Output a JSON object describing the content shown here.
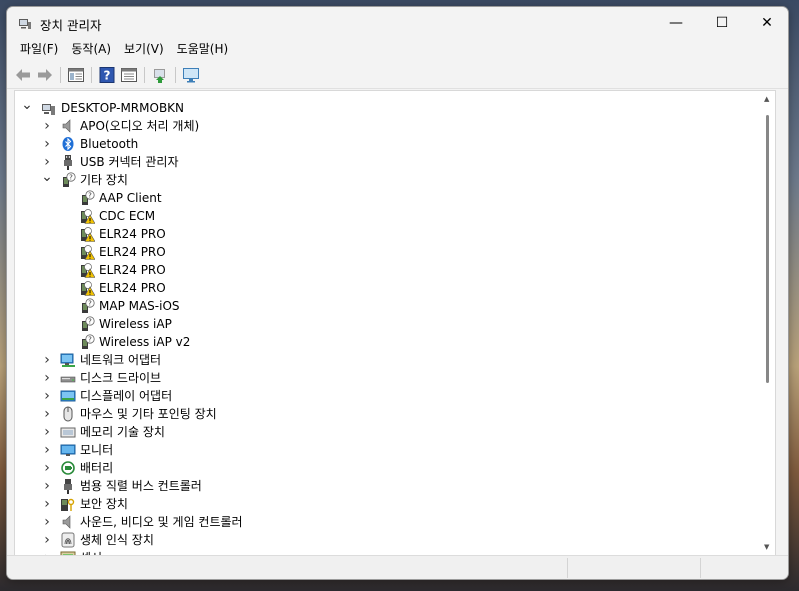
{
  "window": {
    "title": "장치 관리자",
    "controls": {
      "minimize": "—",
      "maximize": "☐",
      "close": "✕"
    }
  },
  "menu": [
    "파일(F)",
    "동작(A)",
    "보기(V)",
    "도움말(H)"
  ],
  "toolbar": [
    "back-icon",
    "forward-icon",
    "properties-view-icon",
    "help-icon",
    "show-hide-console-tree-icon",
    "update-driver-icon",
    "monitor-scan-icon"
  ],
  "tree": {
    "root": "DESKTOP-MRMOBKN",
    "items": [
      {
        "label": "APO(오디오 처리 개체)",
        "icon": "speaker-icon",
        "expanded": false
      },
      {
        "label": "Bluetooth",
        "icon": "bluetooth-icon",
        "expanded": false
      },
      {
        "label": "USB 커넥터 관리자",
        "icon": "usb-plug-icon",
        "expanded": false
      },
      {
        "label": "기타 장치",
        "icon": "unknown-device-icon",
        "expanded": true,
        "children": [
          {
            "label": "AAP Client",
            "icon": "unknown-device-icon"
          },
          {
            "label": "CDC ECM",
            "icon": "warning-device-icon"
          },
          {
            "label": "ELR24 PRO",
            "icon": "warning-device-icon"
          },
          {
            "label": "ELR24 PRO",
            "icon": "warning-device-icon"
          },
          {
            "label": "ELR24 PRO",
            "icon": "warning-device-icon"
          },
          {
            "label": "ELR24 PRO",
            "icon": "warning-device-icon"
          },
          {
            "label": "MAP MAS-iOS",
            "icon": "unknown-device-icon"
          },
          {
            "label": "Wireless iAP",
            "icon": "unknown-device-icon"
          },
          {
            "label": "Wireless iAP v2",
            "icon": "unknown-device-icon"
          }
        ]
      },
      {
        "label": "네트워크 어댑터",
        "icon": "network-adapter-icon",
        "expanded": false
      },
      {
        "label": "디스크 드라이브",
        "icon": "disk-drive-icon",
        "expanded": false
      },
      {
        "label": "디스플레이 어댑터",
        "icon": "display-adapter-icon",
        "expanded": false
      },
      {
        "label": "마우스 및 기타 포인팅 장치",
        "icon": "mouse-icon",
        "expanded": false
      },
      {
        "label": "메모리 기술 장치",
        "icon": "memory-device-icon",
        "expanded": false
      },
      {
        "label": "모니터",
        "icon": "monitor-icon",
        "expanded": false
      },
      {
        "label": "배터리",
        "icon": "battery-icon",
        "expanded": false
      },
      {
        "label": "범용 직렬 버스 컨트롤러",
        "icon": "usb-controller-icon",
        "expanded": false
      },
      {
        "label": "보안 장치",
        "icon": "security-device-icon",
        "expanded": false
      },
      {
        "label": "사운드, 비디오 및 게임 컨트롤러",
        "icon": "sound-icon",
        "expanded": false
      },
      {
        "label": "생체 인식 장치",
        "icon": "fingerprint-icon",
        "expanded": false
      },
      {
        "label": "센서",
        "icon": "sensor-icon",
        "expanded": false
      }
    ]
  },
  "statusbar": {
    "text": ""
  }
}
